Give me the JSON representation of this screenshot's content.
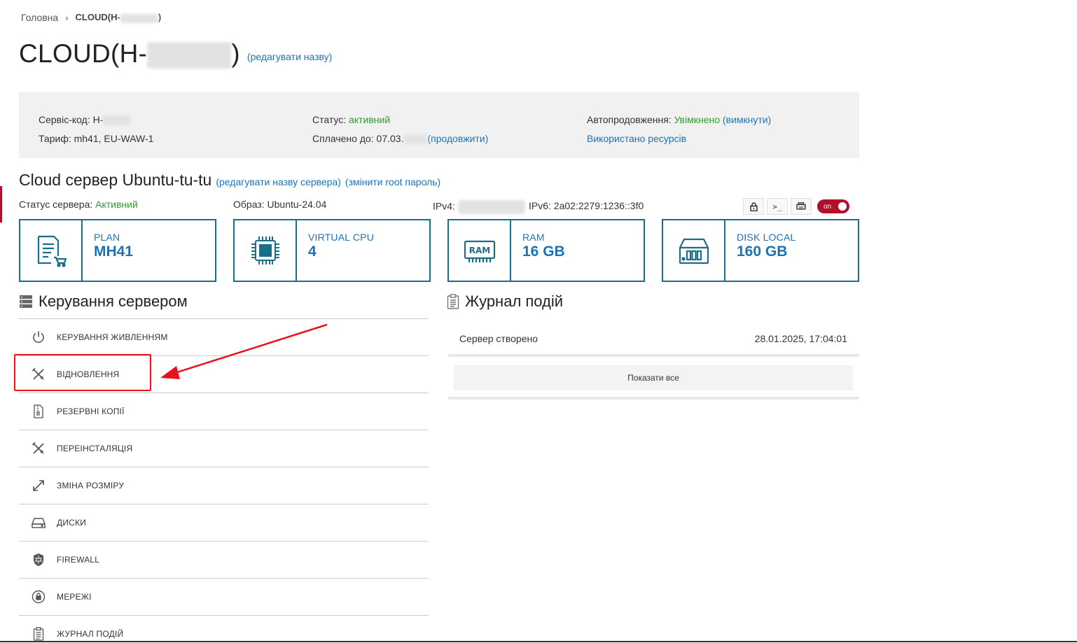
{
  "breadcrumb": {
    "home": "Головна",
    "sep": "›",
    "current": "CLOUD(H-",
    "current_end": ")"
  },
  "title": {
    "prefix": "CLOUD(H-",
    "suffix": ")",
    "edit": "(редагувати назву)"
  },
  "info": {
    "service_code_label": "Сервіс-код: H-",
    "tariff": "Тариф: mh41, EU-WAW-1",
    "status_label": "Статус: ",
    "status_value": "активний",
    "paid_label": "Сплачено до: 07.03.",
    "extend": "(продовжити)",
    "autorenew_label": "Автопродовження: ",
    "autorenew_value": "Увімкнено",
    "disable": "(вимкнути)",
    "resources": "Використано ресурсів"
  },
  "server": {
    "title": "Cloud сервер Ubuntu-tu-tu",
    "edit_name": "(редагувати назву сервера)",
    "change_pass": "(змінити root пароль)",
    "status_label": "Статус сервера: ",
    "status_value": "Активний",
    "image": "Образ: Ubuntu-24.04",
    "ipv4_label": "IPv4:",
    "ipv6": "IPv6: 2a02:2279:1236::3f0",
    "terminal": ">_",
    "toggle": "on"
  },
  "cards": [
    {
      "label": "PLAN",
      "value": "MH41",
      "icon": "plan-icon"
    },
    {
      "label": "VIRTUAL CPU",
      "value": "4",
      "icon": "cpu-icon"
    },
    {
      "label": "RAM",
      "value": "16 GB",
      "icon": "ram-icon"
    },
    {
      "label": "DISK LOCAL",
      "value": "160 GB",
      "icon": "disk-icon"
    }
  ],
  "ram_icon_text": "RAM",
  "management": {
    "title": "Керування сервером",
    "items": [
      {
        "label": "КЕРУВАННЯ ЖИВЛЕННЯМ",
        "icon": "power-icon"
      },
      {
        "label": "ВІДНОВЛЕННЯ",
        "icon": "tools-icon"
      },
      {
        "label": "РЕЗЕРВНІ КОПІЇ",
        "icon": "archive-icon"
      },
      {
        "label": "ПЕРЕІНСТАЛЯЦІЯ",
        "icon": "tools-icon"
      },
      {
        "label": "ЗМІНА РОЗМІРУ",
        "icon": "resize-icon"
      },
      {
        "label": "ДИСКИ",
        "icon": "drive-icon"
      },
      {
        "label": "FIREWALL",
        "icon": "shield-icon"
      },
      {
        "label": "МЕРЕЖІ",
        "icon": "network-icon"
      },
      {
        "label": "ЖУРНАЛ ПОДІЙ",
        "icon": "clipboard-icon"
      }
    ]
  },
  "events": {
    "title": "Журнал подій",
    "rows": [
      {
        "text": "Сервер створено",
        "date": "28.01.2025, 17:04:01"
      }
    ],
    "show_all": "Показати все"
  },
  "colors": {
    "accent": "#1a73b8",
    "card_border": "#1b6e8a",
    "active": "#2e9a2e",
    "toggle": "#b0102a",
    "annotation": "#e8121e"
  }
}
